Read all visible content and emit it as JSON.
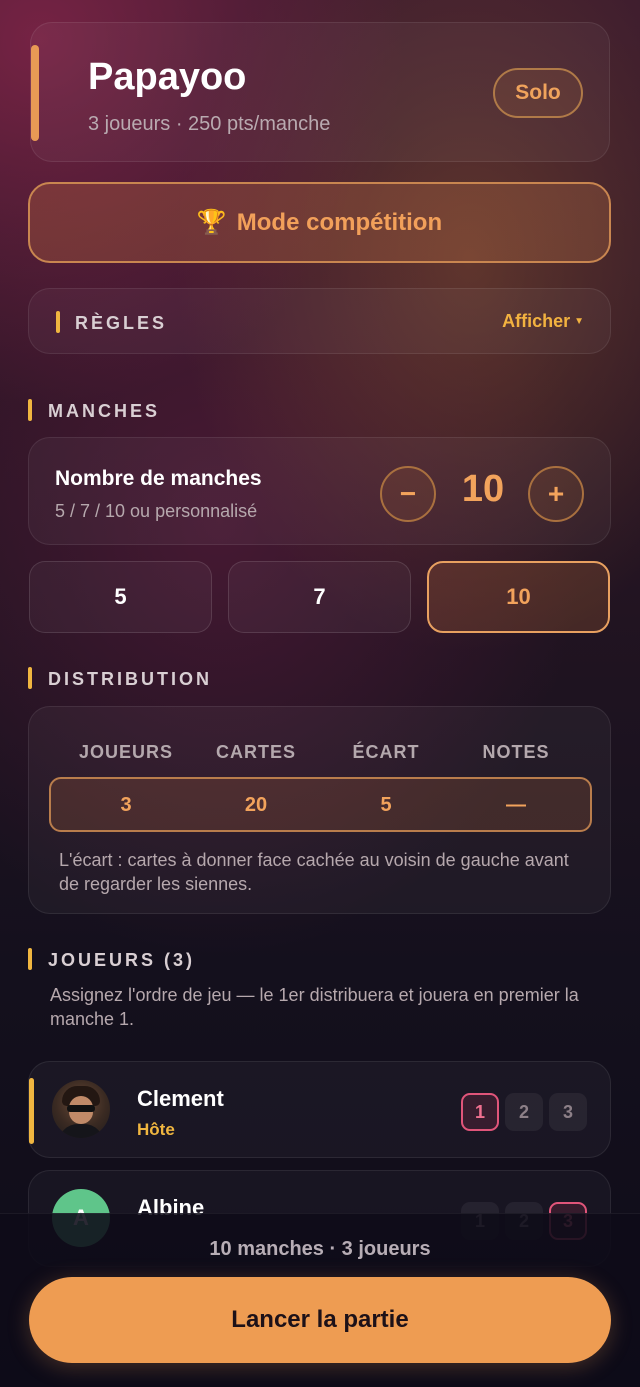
{
  "header": {
    "title": "Papayoo",
    "subtitle": "3 joueurs · 250 pts/manche",
    "mode_badge": "Solo"
  },
  "competition": {
    "icon": "🏆",
    "label": "Mode compétition"
  },
  "rules": {
    "title": "RÈGLES",
    "toggle_label": "Afficher",
    "toggle_caret": "▼"
  },
  "rounds": {
    "section_title": "MANCHES",
    "label": "Nombre de manches",
    "hint": "5 / 7 / 10 ou personnalisé",
    "minus": "−",
    "plus": "+",
    "value": "10",
    "presets": [
      "5",
      "7",
      "10"
    ],
    "selected_preset": "10"
  },
  "distribution": {
    "section_title": "DISTRIBUTION",
    "headers": [
      "JOUEURS",
      "CARTES",
      "ÉCART",
      "NOTES"
    ],
    "values": [
      "3",
      "20",
      "5",
      "—"
    ],
    "note": "L'écart : cartes à donner face cachée au voisin de gauche avant de regarder les siennes."
  },
  "players": {
    "section_title": "JOUEURS (3)",
    "description": "Assignez l'ordre de jeu — le 1er distribuera et jouera en premier la manche 1.",
    "list": [
      {
        "name": "Clement",
        "role": "Hôte",
        "order_options": [
          "1",
          "2",
          "3"
        ],
        "selected_order": "1"
      },
      {
        "name": "Albine",
        "initial": "A",
        "order_options": [
          "1",
          "2",
          "3"
        ],
        "selected_order": "3"
      }
    ]
  },
  "footer": {
    "summary": "10 manches · 3 joueurs",
    "launch_label": "Lancer la partie"
  },
  "colors": {
    "accent_orange": "#ee9c52",
    "accent_yellow": "#f0b640",
    "active_pink": "#e0557a"
  }
}
